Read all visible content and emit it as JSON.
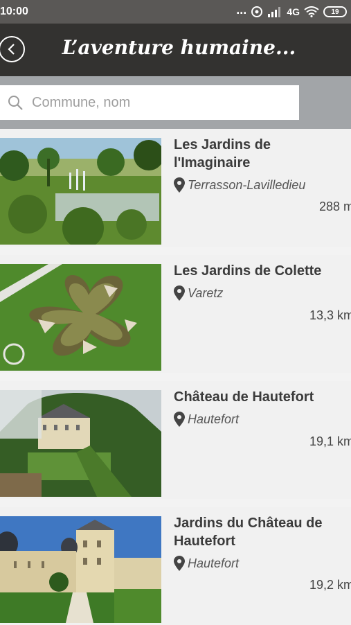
{
  "status": {
    "time": "10:00",
    "dots": "...",
    "network": "4G",
    "battery": "19"
  },
  "header": {
    "title": "L’aventure humaine..."
  },
  "search": {
    "placeholder": "Commune, nom"
  },
  "items": [
    {
      "title": "Les Jardins de l'Imaginaire",
      "location": "Terrasson-Lavilledieu",
      "distance": "288 m"
    },
    {
      "title": "Les Jardins de Colette",
      "location": "Varetz",
      "distance": "13,3 km"
    },
    {
      "title": "Château de Hautefort",
      "location": "Hautefort",
      "distance": "19,1 km"
    },
    {
      "title": "Jardins du Château de Hautefort",
      "location": "Hautefort",
      "distance": "19,2 km"
    }
  ]
}
